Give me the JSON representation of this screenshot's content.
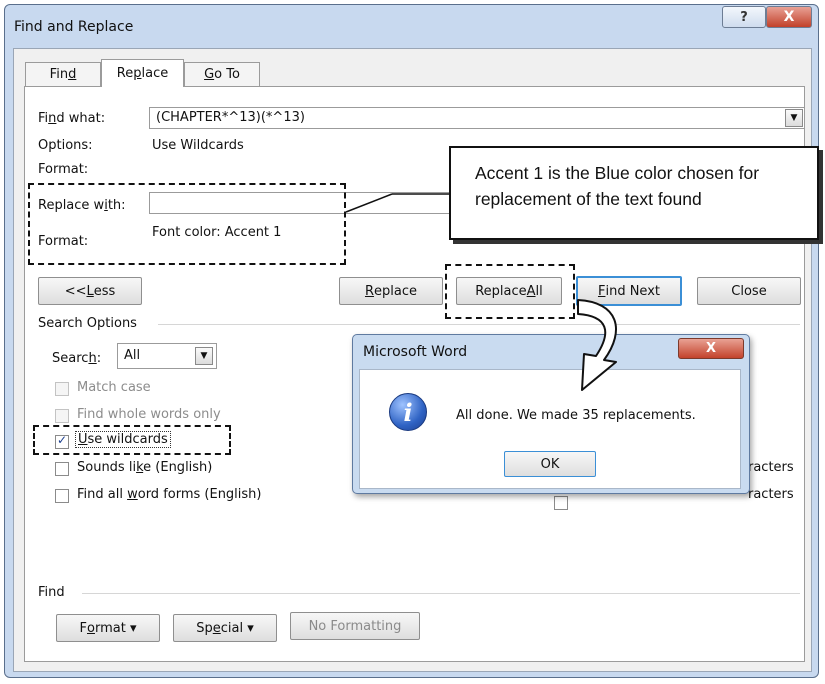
{
  "window": {
    "title": "Find and Replace",
    "help_label": "?",
    "close_label": "X"
  },
  "tabs": [
    {
      "pre": "Fin",
      "u": "d",
      "post": ""
    },
    {
      "pre": "Re",
      "u": "p",
      "post": "lace"
    },
    {
      "pre": "",
      "u": "G",
      "post": "o To"
    }
  ],
  "find": {
    "label_pre": "Fi",
    "label_u": "n",
    "label_post": "d what:",
    "value": "(CHAPTER*^13)(*^13)",
    "options_label": "Options:",
    "options_value": "Use Wildcards",
    "format_label": "Format:"
  },
  "replace": {
    "label_pre": "Replace w",
    "label_u": "i",
    "label_post": "th:",
    "value": "",
    "format_label": "Format:",
    "format_value": "Font color: Accent 1"
  },
  "buttons": {
    "less": {
      "pre": "<< ",
      "u": "L",
      "post": "ess"
    },
    "replace": {
      "pre": "",
      "u": "R",
      "post": "eplace"
    },
    "replace_all": {
      "pre": "Replace ",
      "u": "A",
      "post": "ll"
    },
    "find_next": {
      "pre": "",
      "u": "F",
      "post": "ind Next"
    },
    "close": "Close"
  },
  "search_options": {
    "heading": "Search Options",
    "search_label_pre": "Searc",
    "search_label_u": "h",
    "search_label_post": ":",
    "search_value": "All",
    "match_case": "Match case",
    "whole_words": "Find whole words only",
    "use_wildcards_pre": "",
    "use_wildcards_u": "U",
    "use_wildcards_post": "se wildcards",
    "sounds_like_pre": "Sounds li",
    "sounds_like_u": "k",
    "sounds_like_post": "e (English)",
    "word_forms_pre": "Find all ",
    "word_forms_u": "w",
    "word_forms_post": "ord forms (English)",
    "right_option_1": "racters",
    "right_option_2": "racters"
  },
  "find_section": {
    "heading": "Find",
    "format_pre": "F",
    "format_u": "o",
    "format_post": "rmat ▾",
    "special_pre": "Sp",
    "special_u": "e",
    "special_post": "cial ▾",
    "no_formatting": "No Formatting"
  },
  "message": {
    "title": "Microsoft Word",
    "close_label": "X",
    "text": "All done. We made 35 replacements.",
    "ok": "OK",
    "icon": "i"
  },
  "callout": {
    "line1": "Accent 1 is the Blue color chosen for",
    "line2": "replacement of the text found"
  }
}
